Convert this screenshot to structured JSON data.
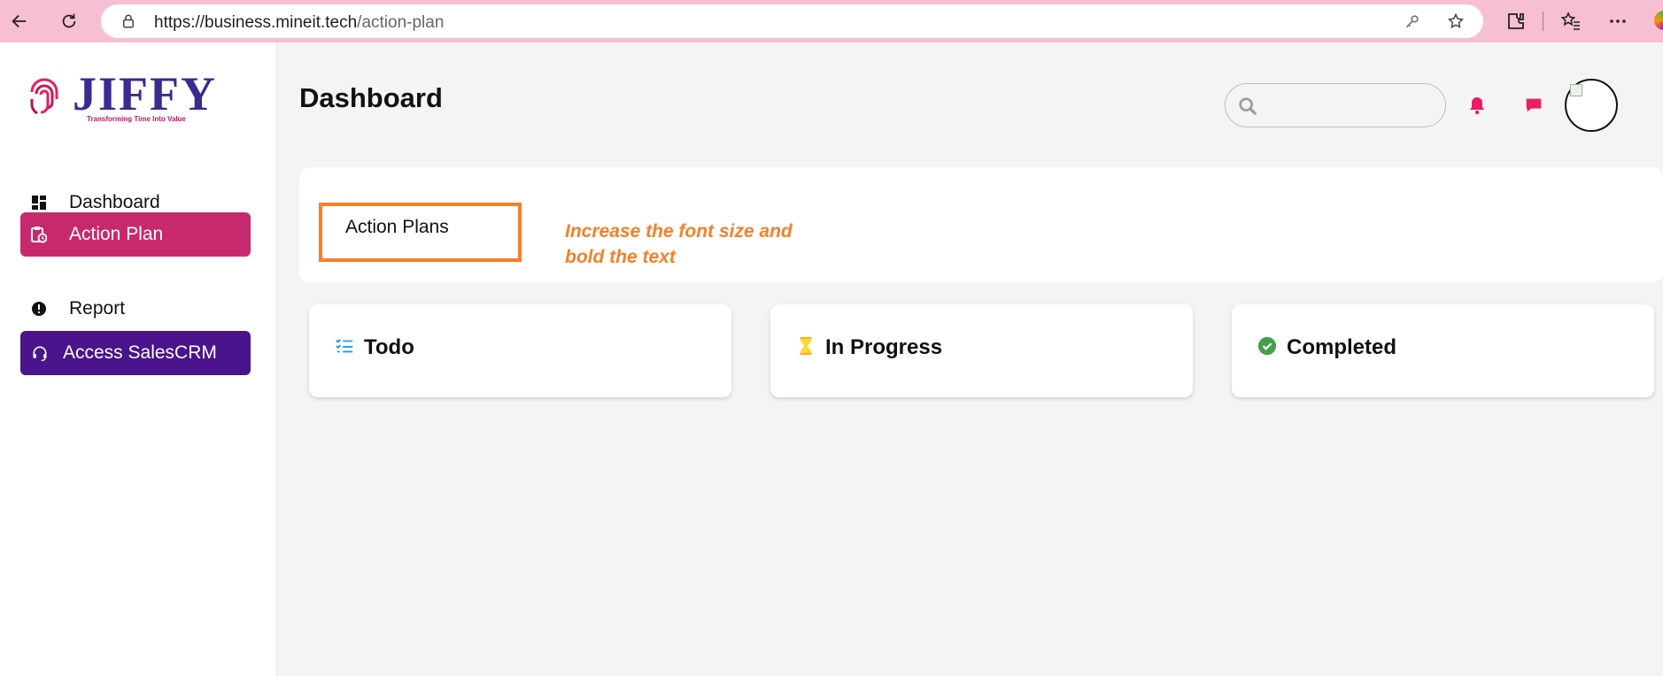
{
  "browser": {
    "url_host": "https://business.mineit.tech",
    "url_path": "/action-plan"
  },
  "sidebar": {
    "logo": {
      "name": "JIFFY",
      "tagline": "Transforming Time Into Value"
    },
    "items": [
      {
        "label": "Dashboard",
        "icon": "grid-icon",
        "active": false
      },
      {
        "label": "Action Plan",
        "icon": "clipboard-clock-icon",
        "active": true
      },
      {
        "label": "Report",
        "icon": "alert-circle-icon",
        "active": false
      }
    ],
    "crm_button": {
      "label": "Access SalesCRM",
      "icon": "headset-icon"
    }
  },
  "main": {
    "title": "Dashboard",
    "search": {
      "placeholder": ""
    },
    "header_card": {
      "tab_label": "Action Plans",
      "annotation": "Increase the font size and bold the text"
    },
    "columns": [
      {
        "title": "Todo",
        "icon": "checklist-icon",
        "color": "#2196f3"
      },
      {
        "title": "In Progress",
        "icon": "hourglass-icon",
        "color": "#fbc02d"
      },
      {
        "title": "Completed",
        "icon": "check-circle-icon",
        "color": "#43a047"
      }
    ]
  },
  "colors": {
    "browser_bar": "#f7bfd3",
    "active_nav": "#c7296e",
    "crm_button": "#4a148c",
    "annotation": "#f3802c",
    "notification_icons": "#e91e63"
  }
}
